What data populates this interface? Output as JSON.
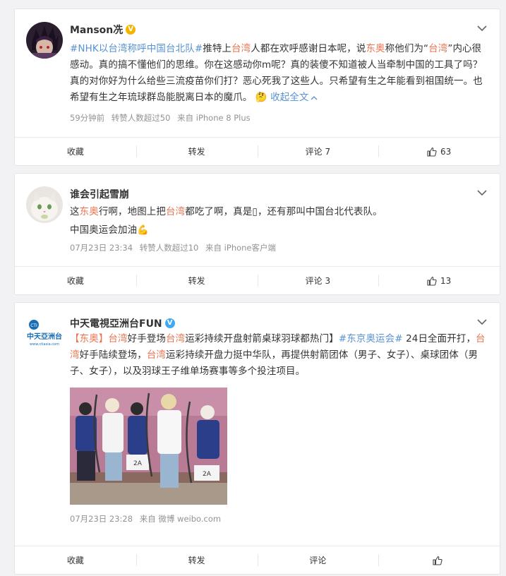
{
  "posts": [
    {
      "username": "Manson冼",
      "badge": "V",
      "text_parts": [
        {
          "t": "#NHK以台湾称呼中国台北队#",
          "c": "tag"
        },
        {
          "t": "推特上",
          "c": ""
        },
        {
          "t": "台湾",
          "c": "link"
        },
        {
          "t": "人都在欢呼感谢日本呢，说",
          "c": ""
        },
        {
          "t": "东奥",
          "c": "link"
        },
        {
          "t": "称他们为“",
          "c": ""
        },
        {
          "t": "台湾",
          "c": "link"
        },
        {
          "t": "”内心很感动。真的搞不懂他们的思维。你在这感动你m呢？真的装傻不知道被人当牵制中国的工具了吗？真的对你好为什么给些三流疫苗你们打？恶心死我了这些人。只希望有生之年能看到祖国统一。也希望有生之年琉球群岛能脱离日本的魔爪。",
          "c": ""
        }
      ],
      "emoji": "🤔",
      "collapse_label": "收起全文",
      "meta": {
        "time": "59分钟前",
        "reposts": "转赞人数超过50",
        "source": "来自 iPhone 8 Plus"
      },
      "actions": {
        "collect": "收藏",
        "repost": "转发",
        "comment": "评论 7",
        "like": "63"
      }
    },
    {
      "username": "谁会引起雪崩",
      "text_parts": [
        {
          "t": "这",
          "c": ""
        },
        {
          "t": "东奥",
          "c": "link"
        },
        {
          "t": "行啊，地图上把",
          "c": ""
        },
        {
          "t": "台湾",
          "c": "link"
        },
        {
          "t": "都吃了啊，真是▯，还有那叫中国台北代表队。",
          "c": ""
        }
      ],
      "line2": "中国奥运会加油💪",
      "meta": {
        "time": "07月23日 23:34",
        "reposts": "转赞人数超过10",
        "source": "来自 iPhone客户端"
      },
      "actions": {
        "collect": "收藏",
        "repost": "转发",
        "comment": "评论 3",
        "like": "13"
      }
    },
    {
      "username": "中天電視亞洲台FUN",
      "badge": "V",
      "avatar_text": "中天亞洲台",
      "avatar_sub": "www.ctiasia.com",
      "avatar_mark": "CTI",
      "text_parts": [
        {
          "t": "【",
          "c": ""
        },
        {
          "t": "东奥",
          "c": "link"
        },
        {
          "t": "】",
          "c": ""
        },
        {
          "t": "台湾",
          "c": "link"
        },
        {
          "t": "好手登场",
          "c": ""
        },
        {
          "t": "台湾",
          "c": "link"
        },
        {
          "t": "运彩持续开盘射箭桌球羽球都热门】",
          "c": ""
        },
        {
          "t": "#东京奥运会#",
          "c": "tag"
        },
        {
          "t": " 24日全面开打，",
          "c": ""
        },
        {
          "t": "台湾",
          "c": "link"
        },
        {
          "t": "好手陆续登场，",
          "c": ""
        },
        {
          "t": "台湾",
          "c": "link"
        },
        {
          "t": "运彩持续开盘力挺中华队，再提供射箭团体（男子、女子）、桌球团体（男子、女子），以及羽球王子维单场赛事等多个投注项目。",
          "c": ""
        }
      ],
      "photo_bibs": [
        "2A",
        "2A"
      ],
      "meta": {
        "time": "07月23日 23:28",
        "source": "来自 微博 weibo.com"
      },
      "actions": {
        "collect": "收藏",
        "repost": "转发",
        "comment": "评论",
        "like": ""
      }
    }
  ],
  "colors": {
    "link": "#eb7350",
    "tag": "#5792d3",
    "meta": "#939393",
    "badge_gold": "#f5b400",
    "badge_blue": "#3fa9f5"
  },
  "icons": [
    "chevron-down-icon",
    "thumbs-up-icon",
    "verified-badge-icon",
    "thinking-emoji-icon",
    "flexed-arm-emoji-icon"
  ]
}
